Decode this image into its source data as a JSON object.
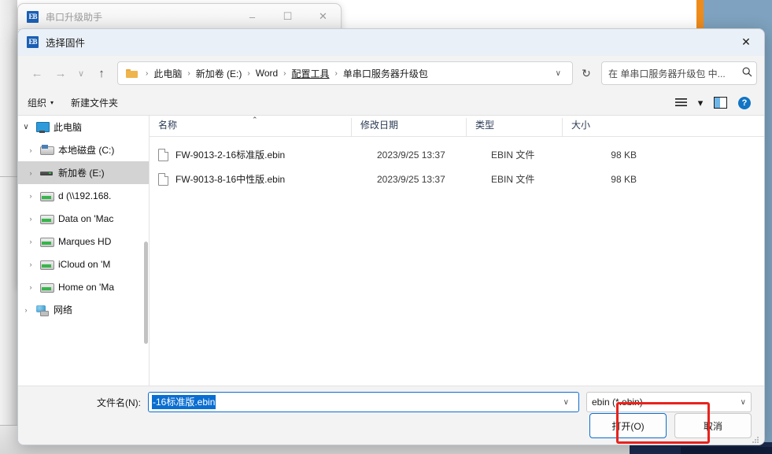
{
  "host_window": {
    "title": "串口升级助手",
    "icon": "app-icon",
    "minimize": "–",
    "maximize": "☐",
    "close": "✕"
  },
  "dialog": {
    "title": "选择固件",
    "close": "✕",
    "nav": {
      "back": "←",
      "forward": "→",
      "recent": "∨",
      "up": "↑",
      "refresh": "↻",
      "dropdown_caret": "∨"
    },
    "breadcrumb": {
      "folder_icon": "folder-icon",
      "separator": "›",
      "items": [
        {
          "label": "此电脑",
          "underline": false
        },
        {
          "label": "新加卷 (E:)",
          "underline": false
        },
        {
          "label": "Word",
          "underline": false
        },
        {
          "label": "配置工具",
          "underline": true
        },
        {
          "label": "单串口服务器升级包",
          "underline": false
        }
      ]
    },
    "search": {
      "placeholder": "在 单串口服务器升级包 中...",
      "icon": "search-icon"
    },
    "toolbar": {
      "organize_label": "组织",
      "organize_caret": "▾",
      "new_folder_label": "新建文件夹",
      "view_icon": "list-view-icon",
      "view_caret": "▾",
      "preview_icon": "preview-pane-icon",
      "help_icon": "?"
    },
    "sidebar": {
      "items": [
        {
          "label": "此电脑",
          "icon": "pc-icon",
          "level": 0,
          "expander": "∨",
          "selected": false
        },
        {
          "label": "本地磁盘 (C:)",
          "icon": "system-drive-icon",
          "level": 1,
          "expander": "›",
          "selected": false
        },
        {
          "label": "新加卷 (E:)",
          "icon": "drive-icon",
          "level": 1,
          "expander": "›",
          "selected": true
        },
        {
          "label": "d (\\\\192.168.",
          "icon": "network-drive-icon",
          "level": 1,
          "expander": "›",
          "selected": false
        },
        {
          "label": "Data on 'Mac",
          "icon": "network-drive-icon",
          "level": 1,
          "expander": "›",
          "selected": false
        },
        {
          "label": "Marques HD",
          "icon": "network-drive-icon",
          "level": 1,
          "expander": "›",
          "selected": false
        },
        {
          "label": "iCloud on 'M",
          "icon": "network-drive-icon",
          "level": 1,
          "expander": "›",
          "selected": false
        },
        {
          "label": "Home on 'Ma",
          "icon": "network-drive-icon",
          "level": 1,
          "expander": "›",
          "selected": false
        },
        {
          "label": "网络",
          "icon": "network-globe-icon",
          "level": 0,
          "expander": "›",
          "selected": false
        }
      ]
    },
    "file_list": {
      "columns": [
        {
          "label": "名称",
          "sorted": true,
          "sort_caret": "⌃"
        },
        {
          "label": "修改日期",
          "sorted": false,
          "sort_caret": ""
        },
        {
          "label": "类型",
          "sorted": false,
          "sort_caret": ""
        },
        {
          "label": "大小",
          "sorted": false,
          "sort_caret": ""
        }
      ],
      "rows": [
        {
          "icon": "file-icon",
          "name": "FW-9013-2-16标准版.ebin",
          "modified": "2023/9/25 13:37",
          "type": "EBIN 文件",
          "size": "98 KB"
        },
        {
          "icon": "file-icon",
          "name": "FW-9013-8-16中性版.ebin",
          "modified": "2023/9/25 13:37",
          "type": "EBIN 文件",
          "size": "98 KB"
        }
      ]
    },
    "footer": {
      "filename_label": "文件名(N):",
      "filename_value": "-16标准版.ebin",
      "filename_caret": "∨",
      "filetype_value": "ebin (*.ebin)",
      "filetype_caret": "∨",
      "open_button": "打开(O)",
      "cancel_button": "取消"
    }
  },
  "colors": {
    "accent": "#0a6ed1",
    "highlight_box": "#e8231c",
    "selection_blue": "#0a6ed1",
    "desktop": "#7ea2bf",
    "titlebar": "#eaf0f7"
  }
}
